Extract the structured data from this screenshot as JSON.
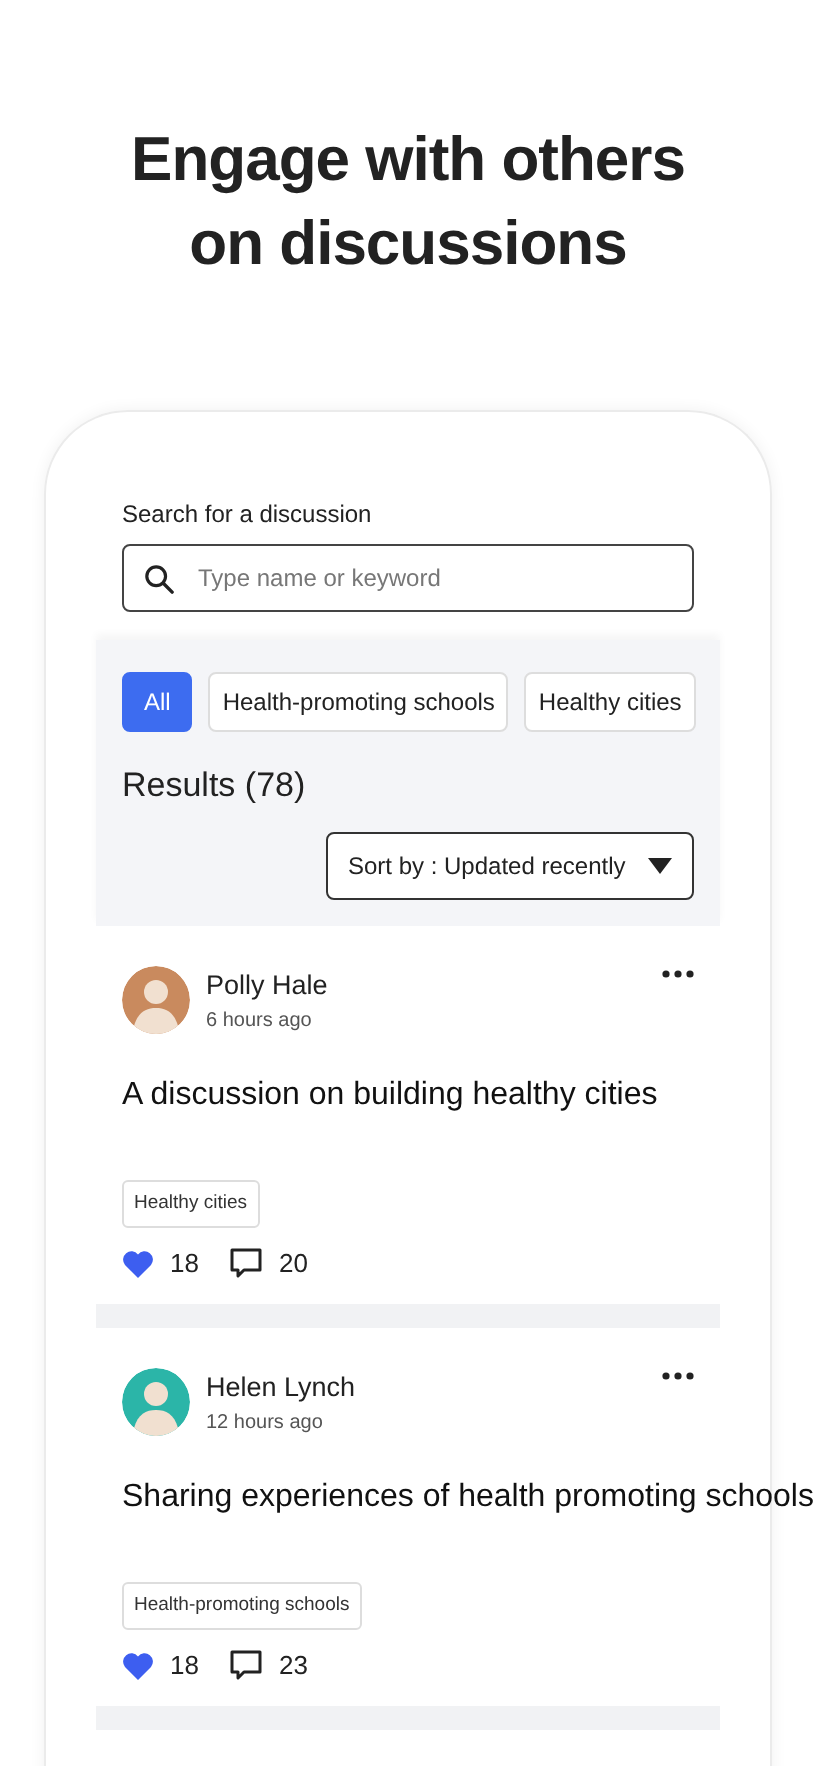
{
  "headline": "Engage with others on discussions",
  "search": {
    "label": "Search for a discussion",
    "placeholder": "Type name or keyword"
  },
  "filters": [
    {
      "label": "All",
      "selected": true
    },
    {
      "label": "Health-promoting schools",
      "selected": false
    },
    {
      "label": "Healthy cities",
      "selected": false
    }
  ],
  "results_title": "Results (78)",
  "sort": {
    "label": "Sort by :",
    "value": "Updated recently"
  },
  "posts": [
    {
      "author": "Polly Hale",
      "time": "6 hours ago",
      "title": "A discussion on building healthy cities",
      "tag": "Healthy cities",
      "liked": true,
      "likes": "18",
      "comments": "20"
    },
    {
      "author": "Helen Lynch",
      "time": "12 hours ago",
      "title": "Sharing experiences of health promoting schools",
      "tag": "Health-promoting schools",
      "liked": true,
      "likes": "18",
      "comments": "23"
    }
  ]
}
